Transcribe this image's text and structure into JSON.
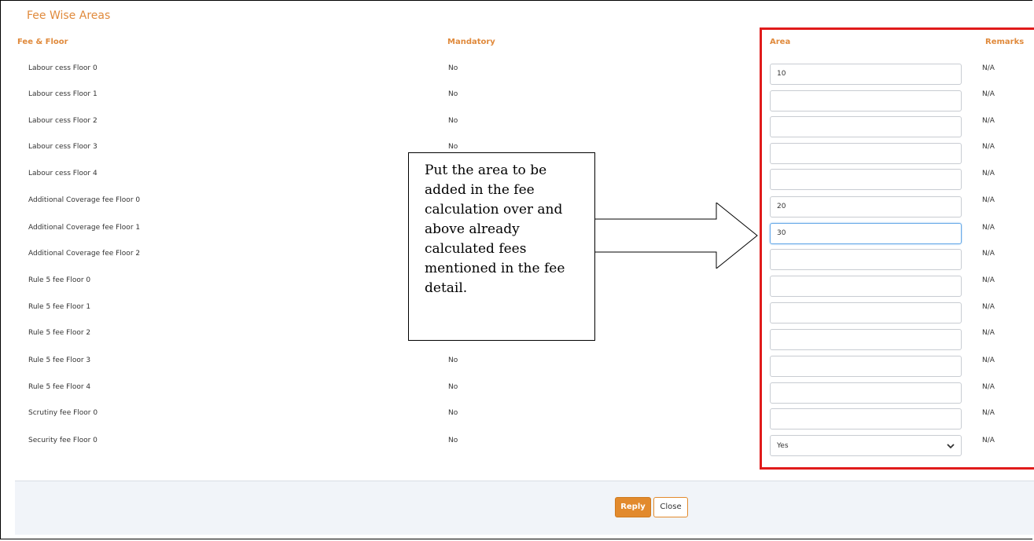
{
  "section_title": "Fee Wise Areas",
  "headers": {
    "fee_floor": "Fee & Floor",
    "mandatory": "Mandatory",
    "area": "Area",
    "remarks": "Remarks"
  },
  "rows": [
    {
      "label": "Labour cess Floor 0",
      "mandatory": "No",
      "area": "10",
      "remarks": "N/A"
    },
    {
      "label": "Labour cess Floor 1",
      "mandatory": "No",
      "area": "",
      "remarks": "N/A"
    },
    {
      "label": "Labour cess Floor 2",
      "mandatory": "No",
      "area": "",
      "remarks": "N/A"
    },
    {
      "label": "Labour cess Floor 3",
      "mandatory": "No",
      "area": "",
      "remarks": "N/A"
    },
    {
      "label": "Labour cess Floor 4",
      "mandatory": "",
      "area": "",
      "remarks": "N/A"
    },
    {
      "label": "Additional Coverage fee Floor 0",
      "mandatory": "",
      "area": "20",
      "remarks": "N/A"
    },
    {
      "label": "Additional Coverage fee Floor 1",
      "mandatory": "",
      "area": "30",
      "remarks": "N/A"
    },
    {
      "label": "Additional Coverage fee Floor 2",
      "mandatory": "",
      "area": "",
      "remarks": "N/A"
    },
    {
      "label": "Rule 5 fee Floor 0",
      "mandatory": "",
      "area": "",
      "remarks": "N/A"
    },
    {
      "label": "Rule 5 fee Floor 1",
      "mandatory": "",
      "area": "",
      "remarks": "N/A"
    },
    {
      "label": "Rule 5 fee Floor 2",
      "mandatory": "",
      "area": "",
      "remarks": "N/A"
    },
    {
      "label": "Rule 5 fee Floor 3",
      "mandatory": "No",
      "area": "",
      "remarks": "N/A"
    },
    {
      "label": "Rule 5 fee Floor 4",
      "mandatory": "No",
      "area": "",
      "remarks": "N/A"
    },
    {
      "label": "Scrutiny fee Floor 0",
      "mandatory": "No",
      "area": "",
      "remarks": "N/A"
    },
    {
      "label": "Security fee Floor 0",
      "mandatory": "No",
      "area": "Yes",
      "remarks": "N/A"
    }
  ],
  "callout_text": "Put the area to be added in the fee calculation over and above already calculated fees mentioned in the fee detail.",
  "buttons": {
    "reply": "Reply",
    "close": "Close"
  },
  "colors": {
    "accent": "#e08a3c",
    "highlight_box": "#e01b1b",
    "primary_button": "#e28a2d"
  }
}
